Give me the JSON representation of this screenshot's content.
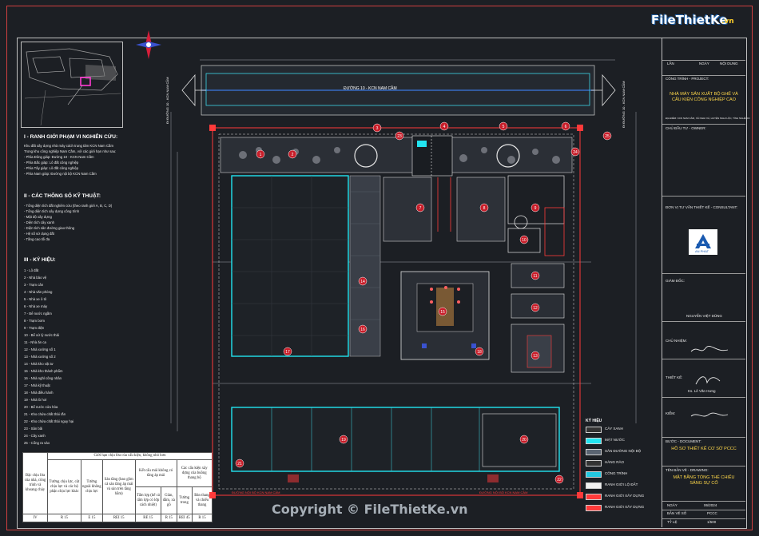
{
  "logo": {
    "brand": "FileThietKe",
    "brand_suffix": ".vn"
  },
  "watermark": {
    "text": "Copyright © FileThietKe.vn"
  },
  "site": {
    "road_label": "ĐƯỜNG 10 - KCN NAM CẦM",
    "left_road_label": "ĐI ĐƯỜNG 10 - KCN NAM CẦM",
    "right_road_label": "ĐI ĐƯỜNG 10 - KCN NAM CẦM",
    "bottom_road_left": "ĐƯỜNG NỘI BỘ KCN NAM CẦM",
    "bottom_road_right": "ĐƯỜNG NỘI BỘ KCN NAM CẦM"
  },
  "notes": {
    "section1_title": "I - RANH GIỚI PHẠM VI NGHIÊN CỨU:",
    "section1_lines": [
      "Khu đất xây dựng nhà máy cách trung tâm KCN Nam Cầm",
      "Trong khu công nghiệp Nam Cầm, với các giới hạn như sau:",
      "- Phía Đông giáp: Đường 10 - KCN Nam Cầm",
      "- Phía Bắc giáp: Lô đất công nghiệp",
      "- Phía Tây giáp: Lô đất công nghiệp",
      "- Phía Nam giáp: Đường nội bộ KCN Nam Cầm"
    ],
    "section2_title": "II - CÁC THÔNG SỐ KỸ THUẬT:",
    "section2_lines": [
      "- Tổng diện tích đất nghiên cứu (theo ranh giới A, B, C, D)",
      "- Tổng diện tích xây dựng công trình",
      "- Mật độ xây dựng",
      "- Diện tích cây xanh",
      "- Diện tích sân đường giao thông",
      "- Hệ số sử dụng đất",
      "- Tầng cao tối đa"
    ],
    "section3_title": "III - KÝ HIỆU:",
    "section3_items": [
      "1 - Lô đất",
      "2 - Nhà bảo vệ",
      "3 - Trạm cân",
      "4 - Nhà văn phòng",
      "5 - Nhà xe ô tô",
      "6 - Nhà xe máy",
      "7 - Bể nước ngầm",
      "8 - Trạm bơm",
      "9 - Trạm điện",
      "10 - Bể xử lý nước thải",
      "11 - Nhà ăn ca",
      "12 - Nhà xưởng số 1",
      "13 - Nhà xưởng số 2",
      "14 - Nhà kho vật tư",
      "15 - Nhà kho thành phẩm",
      "16 - Nhà nghỉ công nhân",
      "17 - Nhà kỹ thuật",
      "18 - Nhà điều hành",
      "19 - Nhà lò hơi",
      "20 - Bể nước cứu hỏa",
      "21 - Kho chứa chất thải rắn",
      "22 - Kho chứa chất thải nguy hại",
      "23 - Sân bãi",
      "24 - Cây xanh",
      "25 - Cổng ra vào"
    ]
  },
  "fire_table": {
    "title": "Giới hạn chịu lửa của cấu kiện, không nhỏ hơn",
    "col_headers": [
      "Bậc chịu lửa của nhà, công trình và khoang cháy",
      "Tường chịu lực, cột chịu lực và các bộ phận chịu lực khác",
      "Tường ngoài không chịu lực",
      "Sàn tầng (bao gồm cả sàn tầng áp mái và sàn trên tầng hầm)",
      "Kết cấu mái không có tầng áp mái",
      "Các cấu kiện xây dựng của buồng thang bộ"
    ],
    "sub_headers": [
      "Tấm lợp (kể cả tấm lợp có lớp cách nhiệt)",
      "Giàn, dầm, xà gồ",
      "Tường trong",
      "Bản thang và chiếu thang"
    ],
    "values": [
      "IV",
      "R 15",
      "E 15",
      "REI 15",
      "RE 15",
      "R 15",
      "REI 45",
      "R 15"
    ]
  },
  "legend": {
    "title": "KÝ HIỆU",
    "items": [
      {
        "label": "CÂY XANH",
        "color": "#333333"
      },
      {
        "label": "MẶT NƯỚC",
        "color": "#22e4f0"
      },
      {
        "label": "SÂN ĐƯỜNG NỘI BỘ",
        "color": "#5a6472"
      },
      {
        "label": "HÀNG RÀO",
        "color": "#333333"
      },
      {
        "label": "CÔNG TRÌNH",
        "color": "#22c8e0"
      },
      {
        "label": "RANH GIỚI LỘ ĐẤT",
        "color": "#f0f0f0"
      },
      {
        "label": "RANH GIỚI XÂY DỰNG",
        "color": "#ff3a3a"
      },
      {
        "label": "RANH GIỚI XÂY DỰNG",
        "color": "#ff3a3a"
      }
    ]
  },
  "title_block": {
    "project_label": "CÔNG TRÌNH - PROJECT:",
    "project_name": "NHÀ MÁY SẢN XUẤT BỘ GHẾ VÀ CẤU KIỆN CÔNG NGHIỆP CAO",
    "project_address": "ĐỊA ĐIỂM: KCN NAM CẦM, XÃ NGHI XÁ, HUYỆN NGHI LỘC, TỈNH NGHỆ AN",
    "owner_label": "CHỦ ĐẦU TƯ - OWNER:",
    "consultant_label": "ĐƠN VỊ TƯ VẤN THIẾT KẾ - CONSULTANT:",
    "consultant_name": "AN PHAT",
    "director_label": "GIÁM ĐỐC:",
    "director_name": "NGUYỄN VIỆT DŨNG",
    "chief_label": "CHỦ NHIỆM:",
    "designer_label": "THIẾT KẾ:",
    "designer_name": "Ks. Lê Văn Hưng",
    "checker_label": "KIỂM:",
    "doc_label": "BƯỚC - DOCUMENT:",
    "doc_name": "HỒ SƠ THIẾT KẾ CƠ SỞ PCCC",
    "drawing_label": "TÊN BẢN VẼ - DRAWING:",
    "drawing_name": "MẶT BẰNG TỔNG THỂ CHIẾU SÁNG SỰ CỐ",
    "date_label": "NGÀY",
    "date_value": "06/2024",
    "sheet_label": "BẢN VẼ SỐ",
    "sheet_value": "PCCC",
    "scale_label": "TỶ LỆ",
    "scale_value": "1/500",
    "top_cells": [
      "LẦN",
      "NGÀY",
      "NỘI DUNG"
    ]
  },
  "building_numbers": [
    "1",
    "2",
    "3",
    "4",
    "5",
    "6",
    "7",
    "8",
    "9",
    "10",
    "11",
    "12",
    "13",
    "14",
    "15",
    "16",
    "17",
    "18",
    "19",
    "20",
    "21",
    "22",
    "23",
    "24",
    "25"
  ]
}
